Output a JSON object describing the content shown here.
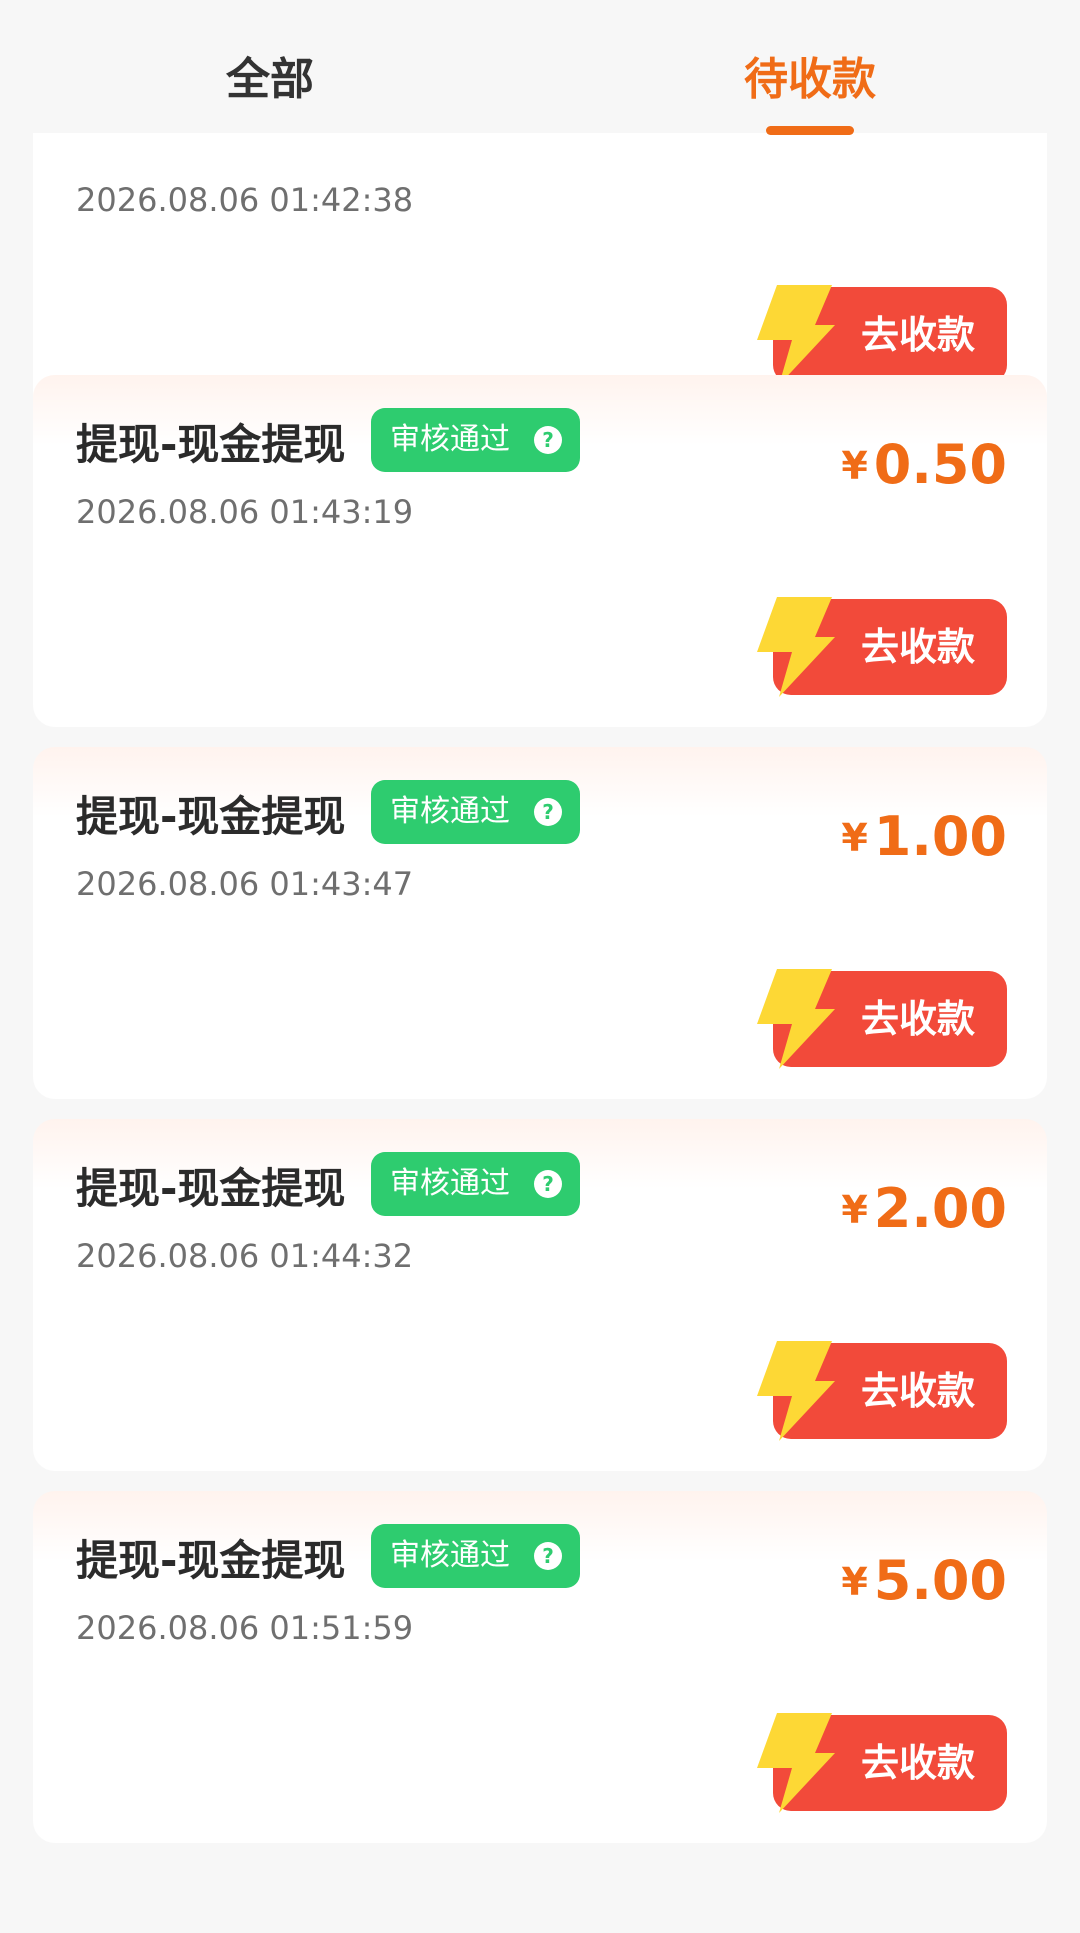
{
  "tabs": {
    "all_label": "全部",
    "pending_label": "待收款",
    "active": "待收款"
  },
  "partial_card": {
    "time": "2026.08.06 01:42:38",
    "button_label": "去收款"
  },
  "records": [
    {
      "title": "提现-现金提现",
      "status": "审核通过",
      "time": "2026.08.06 01:43:19",
      "currency": "¥",
      "amount": "0.50",
      "button_label": "去收款"
    },
    {
      "title": "提现-现金提现",
      "status": "审核通过",
      "time": "2026.08.06 01:43:47",
      "currency": "¥",
      "amount": "1.00",
      "button_label": "去收款"
    },
    {
      "title": "提现-现金提现",
      "status": "审核通过",
      "time": "2026.08.06 01:44:32",
      "currency": "¥",
      "amount": "2.00",
      "button_label": "去收款"
    },
    {
      "title": "提现-现金提现",
      "status": "审核通过",
      "time": "2026.08.06 01:51:59",
      "currency": "¥",
      "amount": "5.00",
      "button_label": "去收款"
    }
  ],
  "icons": {
    "help": "question-circle-icon",
    "bolt": "lightning-bolt-icon"
  },
  "colors": {
    "accent": "#f06c17",
    "status_green": "#2ecc6f",
    "button_red": "#f24a3a",
    "bolt_yellow": "#fdd835"
  }
}
